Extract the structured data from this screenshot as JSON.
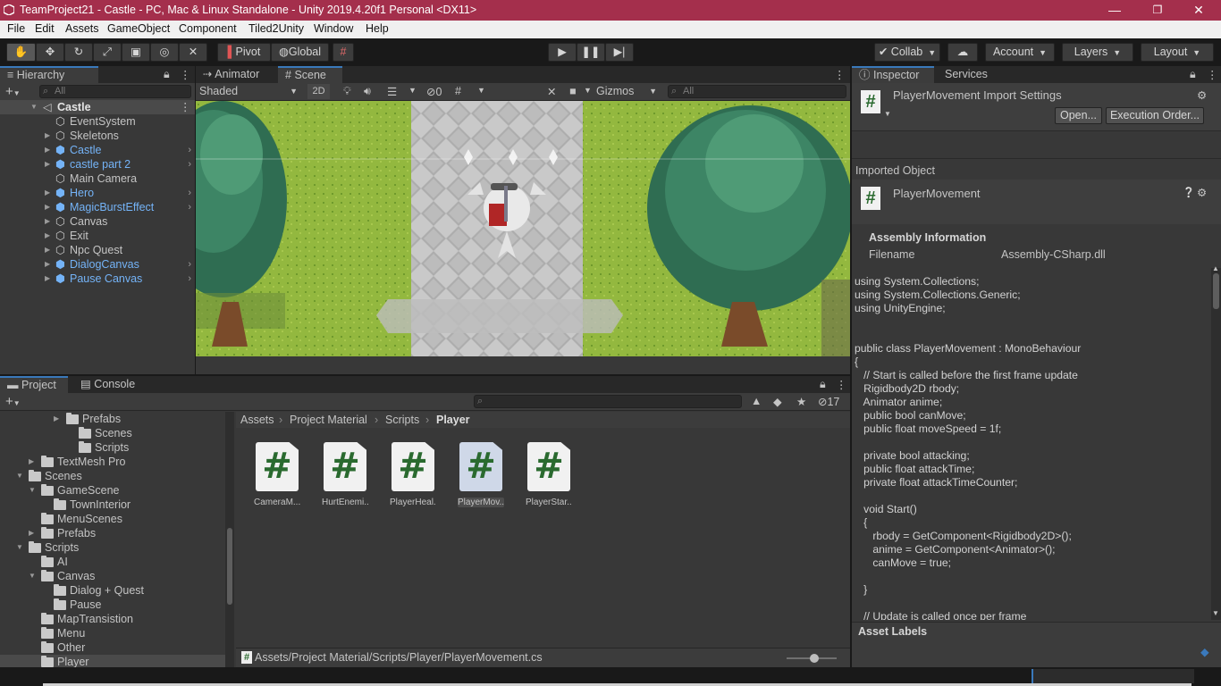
{
  "title_bar": {
    "title": "TeamProject21 - Castle - PC, Mac & Linux Standalone - Unity 2019.4.20f1 Personal <DX11>",
    "minimize": "—",
    "restore": "❐",
    "close": "✕"
  },
  "menu": {
    "items": [
      "File",
      "Edit",
      "Assets",
      "GameObject",
      "Component",
      "Tiled2Unity",
      "Window",
      "Help"
    ]
  },
  "toolbar": {
    "pivot": "Pivot",
    "global": "Global",
    "collab": "Collab",
    "account": "Account",
    "layers": "Layers",
    "layout": "Layout"
  },
  "hierarchy": {
    "tab": "Hierarchy",
    "search_placeholder": "All",
    "scene": "Castle",
    "items": [
      {
        "label": "EventSystem",
        "prefab": false,
        "expandable": false
      },
      {
        "label": "Skeletons",
        "prefab": false,
        "expandable": true
      },
      {
        "label": "Castle",
        "prefab": true,
        "expandable": true
      },
      {
        "label": "castle part 2",
        "prefab": true,
        "expandable": true
      },
      {
        "label": "Main Camera",
        "prefab": false,
        "expandable": false
      },
      {
        "label": "Hero",
        "prefab": true,
        "expandable": true
      },
      {
        "label": "MagicBurstEffect",
        "prefab": true,
        "expandable": true
      },
      {
        "label": "Canvas",
        "prefab": false,
        "expandable": true
      },
      {
        "label": "Exit",
        "prefab": false,
        "expandable": true
      },
      {
        "label": "Npc Quest",
        "prefab": false,
        "expandable": true
      },
      {
        "label": "DialogCanvas",
        "prefab": true,
        "expandable": true
      },
      {
        "label": "Pause Canvas",
        "prefab": true,
        "expandable": true
      }
    ]
  },
  "scene_view": {
    "tabs": [
      "Animator",
      "Scene"
    ],
    "shading": "Shaded",
    "mode2d": "2D",
    "hidden_count": "0",
    "gizmos": "Gizmos",
    "search_placeholder": "All"
  },
  "project": {
    "tabs": [
      "Project",
      "Console"
    ],
    "hidden_count": "17",
    "tree": [
      {
        "label": "Prefabs",
        "indent": 4,
        "arrow": "▶"
      },
      {
        "label": "Scenes",
        "indent": 5,
        "arrow": ""
      },
      {
        "label": "Scripts",
        "indent": 5,
        "arrow": ""
      },
      {
        "label": "TextMesh Pro",
        "indent": 2,
        "arrow": "▶"
      },
      {
        "label": "Scenes",
        "indent": 1,
        "arrow": "▼"
      },
      {
        "label": "GameScene",
        "indent": 2,
        "arrow": "▼"
      },
      {
        "label": "TownInterior",
        "indent": 3,
        "arrow": ""
      },
      {
        "label": "MenuScenes",
        "indent": 2,
        "arrow": ""
      },
      {
        "label": "Prefabs",
        "indent": 2,
        "arrow": "▶"
      },
      {
        "label": "Scripts",
        "indent": 1,
        "arrow": "▼"
      },
      {
        "label": "AI",
        "indent": 2,
        "arrow": ""
      },
      {
        "label": "Canvas",
        "indent": 2,
        "arrow": "▼"
      },
      {
        "label": "Dialog + Quest",
        "indent": 3,
        "arrow": ""
      },
      {
        "label": "Pause",
        "indent": 3,
        "arrow": ""
      },
      {
        "label": "MapTransistion",
        "indent": 2,
        "arrow": ""
      },
      {
        "label": "Menu",
        "indent": 2,
        "arrow": ""
      },
      {
        "label": "Other",
        "indent": 2,
        "arrow": ""
      },
      {
        "label": "Player",
        "indent": 2,
        "arrow": ""
      }
    ],
    "breadcrumb": [
      "Assets",
      "Project Material",
      "Scripts",
      "Player"
    ],
    "files": [
      "CameraM...",
      "HurtEnemi...",
      "PlayerHeal...",
      "PlayerMov...",
      "PlayerStar..."
    ],
    "selected_file": 3,
    "path": "Assets/Project Material/Scripts/Player/PlayerMovement.cs"
  },
  "inspector": {
    "tabs": [
      "Inspector",
      "Services"
    ],
    "title": "PlayerMovement Import Settings",
    "open_button": "Open...",
    "exec_order_button": "Execution Order...",
    "imported_object": "Imported Object",
    "object_name": "PlayerMovement",
    "assembly_header": "Assembly Information",
    "filename_label": "Filename",
    "filename_value": "Assembly-CSharp.dll",
    "code_lines": [
      "using System.Collections;",
      "using System.Collections.Generic;",
      "using UnityEngine;",
      "",
      "",
      "public class PlayerMovement : MonoBehaviour",
      "{",
      "   // Start is called before the first frame update",
      "   Rigidbody2D rbody;",
      "   Animator anime;",
      "   public bool canMove;",
      "   public float moveSpeed = 1f;",
      "",
      "   private bool attacking;",
      "   public float attackTime;",
      "   private float attackTimeCounter;",
      "",
      "   void Start()",
      "   {",
      "      rbody = GetComponent<Rigidbody2D>();",
      "      anime = GetComponent<Animator>();",
      "      canMove = true;",
      "",
      "   }",
      "",
      "   // Update is called once per frame"
    ],
    "asset_labels": "Asset Labels"
  },
  "colors": {
    "title_bar": "#a42f4c",
    "accent": "#3a79bb",
    "prefab_text": "#74b3f7",
    "script_icon": "#2a6a2f"
  }
}
